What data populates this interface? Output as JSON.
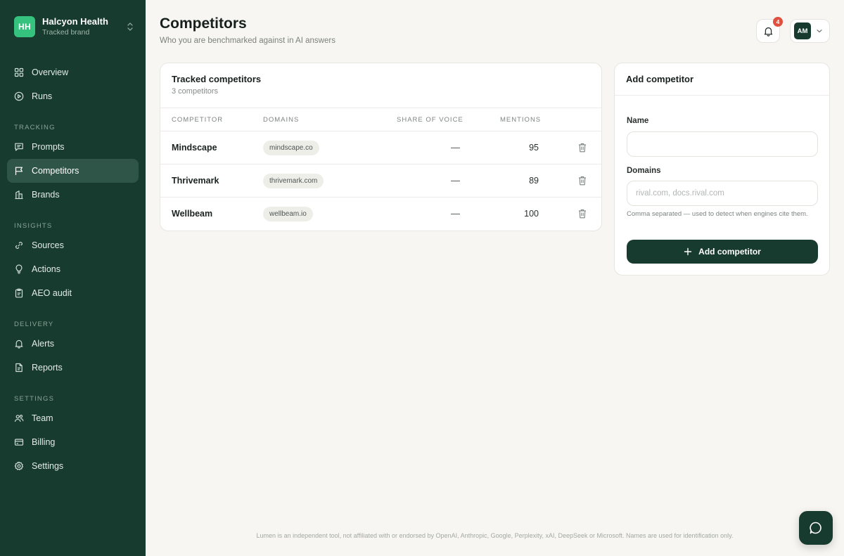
{
  "brand": {
    "initials": "HH",
    "name": "Halcyon Health",
    "subtitle": "Tracked brand"
  },
  "nav": {
    "top": [
      {
        "label": "Overview",
        "icon": "grid-icon"
      },
      {
        "label": "Runs",
        "icon": "play-circle-icon"
      }
    ],
    "sections": [
      {
        "title": "TRACKING",
        "items": [
          {
            "label": "Prompts",
            "icon": "message-icon"
          },
          {
            "label": "Competitors",
            "icon": "flag-icon",
            "active": true
          },
          {
            "label": "Brands",
            "icon": "building-icon"
          }
        ]
      },
      {
        "title": "INSIGHTS",
        "items": [
          {
            "label": "Sources",
            "icon": "link-icon"
          },
          {
            "label": "Actions",
            "icon": "lightbulb-icon"
          },
          {
            "label": "AEO audit",
            "icon": "clipboard-icon"
          }
        ]
      },
      {
        "title": "DELIVERY",
        "items": [
          {
            "label": "Alerts",
            "icon": "bell-icon"
          },
          {
            "label": "Reports",
            "icon": "document-icon"
          }
        ]
      },
      {
        "title": "SETTINGS",
        "items": [
          {
            "label": "Team",
            "icon": "users-icon"
          },
          {
            "label": "Billing",
            "icon": "credit-card-icon"
          },
          {
            "label": "Settings",
            "icon": "gear-icon"
          }
        ]
      }
    ]
  },
  "header": {
    "title": "Competitors",
    "subtitle": "Who you are benchmarked against in AI answers",
    "notification_count": "4",
    "user_initials": "AM"
  },
  "tracked": {
    "title": "Tracked competitors",
    "subtitle": "3 competitors",
    "columns": {
      "competitor": "COMPETITOR",
      "domains": "DOMAINS",
      "share": "SHARE OF VOICE",
      "mentions": "MENTIONS"
    },
    "rows": [
      {
        "name": "Mindscape",
        "domain": "mindscape.co",
        "share": "—",
        "mentions": "95"
      },
      {
        "name": "Thrivemark",
        "domain": "thrivemark.com",
        "share": "—",
        "mentions": "89"
      },
      {
        "name": "Wellbeam",
        "domain": "wellbeam.io",
        "share": "—",
        "mentions": "100"
      }
    ]
  },
  "add_form": {
    "title": "Add competitor",
    "name_label": "Name",
    "name_value": "",
    "name_placeholder": "",
    "domains_label": "Domains",
    "domains_value": "",
    "domains_placeholder": "rival.com, docs.rival.com",
    "help": "Comma separated — used to detect when engines cite them.",
    "submit_label": "Add competitor"
  },
  "footer": "Lumen is an independent tool, not affiliated with or endorsed by OpenAI, Anthropic, Google, Perplexity, xAI, DeepSeek or Microsoft. Names are used for identification only.",
  "colors": {
    "sidebar": "#173b2f",
    "accent": "#35c27f",
    "badge": "#e0503f",
    "background": "#f7f6f2"
  }
}
